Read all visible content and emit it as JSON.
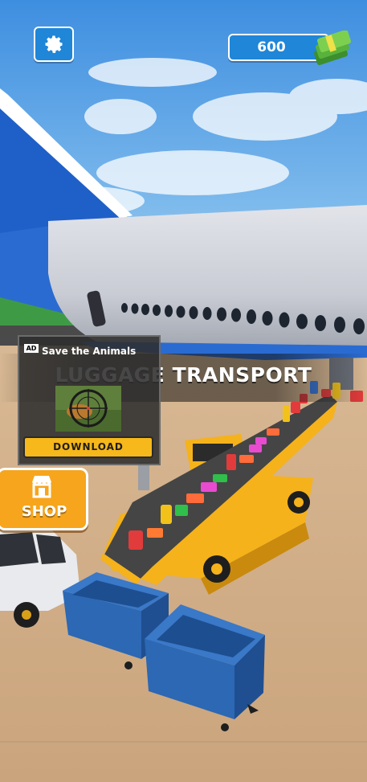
{
  "hud": {
    "money": "600",
    "settings_icon": "gear-icon",
    "money_icon": "cash-stack-icon"
  },
  "game": {
    "title": "LUGGAGE TRANSPORT"
  },
  "ad": {
    "badge": "AD",
    "title": "Save the Animals",
    "cta": "DOWNLOAD",
    "thumbnail_icon": "sniper-scope-icon"
  },
  "shop": {
    "label": "SHOP",
    "icon": "storefront-icon"
  },
  "colors": {
    "hud_blue": "#1f86d8",
    "shop_orange": "#f7a51c",
    "download_yellow": "#f6b81a",
    "truck_yellow": "#f5b21a",
    "cart_blue": "#2c68b4"
  }
}
